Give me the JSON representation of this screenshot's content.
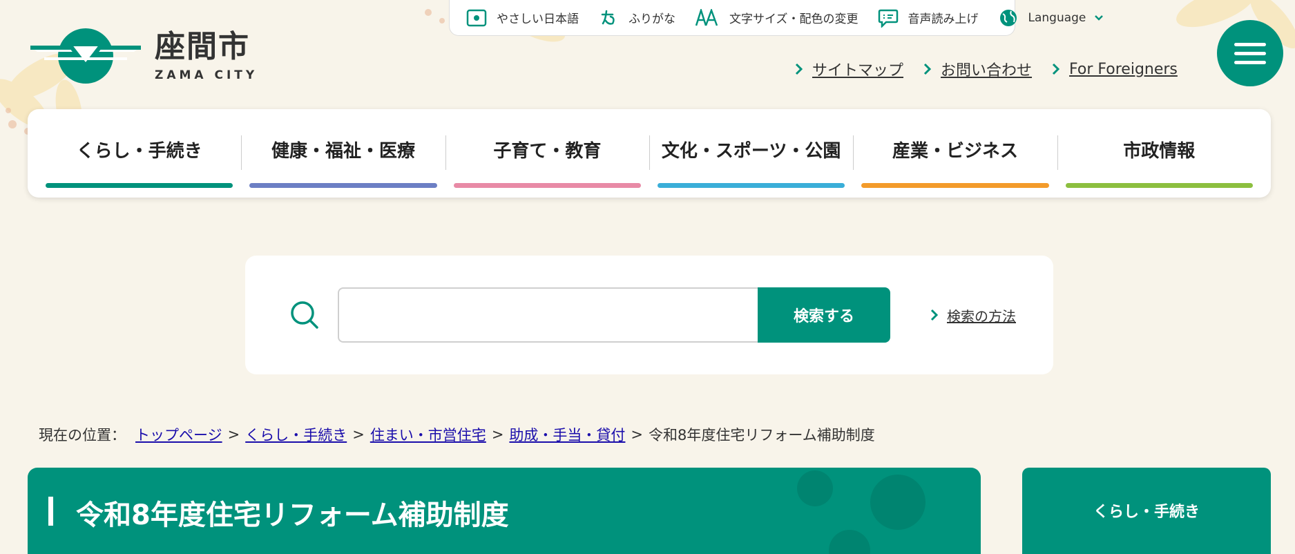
{
  "header": {
    "logo_jp": "座間市",
    "logo_en": "ZAMA CITY"
  },
  "utility": {
    "items": [
      {
        "label": "やさしい日本語",
        "icon": "easy-japanese-icon"
      },
      {
        "label": "ふりがな",
        "icon": "furigana-icon"
      },
      {
        "label": "文字サイズ・配色の変更",
        "icon": "text-size-icon"
      },
      {
        "label": "音声読み上げ",
        "icon": "speech-icon"
      },
      {
        "label": "Language",
        "icon": "globe-icon"
      }
    ]
  },
  "quick_links": [
    "サイトマップ",
    "お問い合わせ",
    "For Foreigners"
  ],
  "gnav": {
    "items": [
      {
        "label": "くらし・手続き",
        "color": "#00927c"
      },
      {
        "label": "健康・福祉・医療",
        "color": "#6c7fc4"
      },
      {
        "label": "子育て・教育",
        "color": "#e88aa6"
      },
      {
        "label": "文化・スポーツ・公園",
        "color": "#3aaed8"
      },
      {
        "label": "産業・ビジネス",
        "color": "#f39b2b"
      },
      {
        "label": "市政情報",
        "color": "#8cbf3f"
      }
    ]
  },
  "search": {
    "placeholder": "",
    "button_label": "検索する",
    "help_label": "検索の方法"
  },
  "breadcrumb": {
    "prefix": "現在の位置：",
    "links": [
      "トップページ",
      "くらし・手続き",
      "住まい・市営住宅",
      "助成・手当・貸付"
    ],
    "current": "令和8年度住宅リフォーム補助制度"
  },
  "page": {
    "title": "令和8年度住宅リフォーム補助制度"
  },
  "sidebar": {
    "title": "くらし・手続き"
  },
  "colors": {
    "brand": "#00927c",
    "background": "#f8f4ea"
  }
}
